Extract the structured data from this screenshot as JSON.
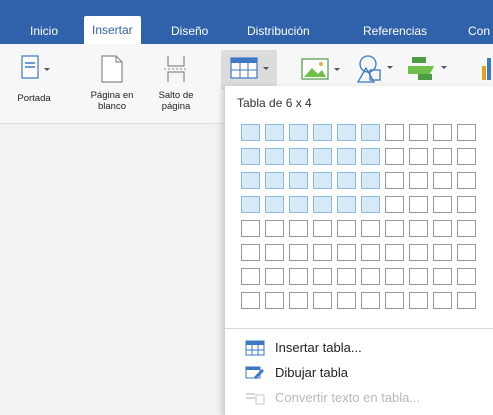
{
  "tabs": [
    {
      "label": "Inicio"
    },
    {
      "label": "Insertar",
      "active": true
    },
    {
      "label": "Diseño"
    },
    {
      "label": "Distribución"
    },
    {
      "label": "Referencias"
    },
    {
      "label": "Con"
    }
  ],
  "ribbon": {
    "cover_label": "Portada",
    "blank_page_label": "Página en\nblanco",
    "page_break_label": "Salto de\npágina"
  },
  "table_menu": {
    "grid_title": "Tabla de 6 x 4",
    "grid_rows": 8,
    "grid_cols": 10,
    "selected_rows": 4,
    "selected_cols": 6,
    "items": [
      {
        "label": "Insertar tabla...",
        "icon": "insert-table-icon",
        "enabled": true
      },
      {
        "label": "Dibujar tabla",
        "icon": "draw-table-icon",
        "enabled": true
      },
      {
        "label": "Convertir texto en tabla...",
        "icon": "convert-text-icon",
        "enabled": false
      }
    ]
  },
  "colors": {
    "ribbon_blue": "#2f62ab",
    "selected_cell": "#d6e9f8"
  }
}
